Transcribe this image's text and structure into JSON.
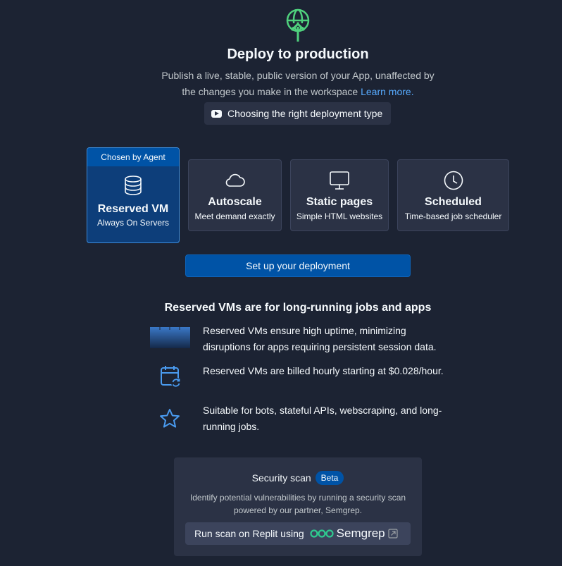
{
  "header": {
    "icon": "globe-upload-icon",
    "title": "Deploy to production",
    "subtitle_line1": "Publish a live, stable, public version of your App, unaffected by",
    "subtitle_line2": "the changes you make in the workspace",
    "learn_more": "Learn more.",
    "video_button": "Choosing the right deployment type"
  },
  "deployment_types": [
    {
      "name": "Reserved VM",
      "desc": "Always On Servers",
      "icon": "database-icon",
      "tag": "Chosen by Agent",
      "selected": true
    },
    {
      "name": "Autoscale",
      "desc": "Meet demand exactly",
      "icon": "cloud-icon",
      "selected": false
    },
    {
      "name": "Static pages",
      "desc": "Simple HTML websites",
      "icon": "monitor-icon",
      "selected": false
    },
    {
      "name": "Scheduled",
      "desc": "Time-based job scheduler",
      "icon": "clock-icon",
      "selected": false
    }
  ],
  "setup_button": "Set up your deployment",
  "info": {
    "title": "Reserved VMs are for long-running jobs and apps",
    "features": [
      {
        "icon": "uptime-bar-icon",
        "text": "Reserved VMs ensure high uptime, minimizing disruptions for apps requiring persistent session data."
      },
      {
        "icon": "calendar-repeat-icon",
        "text": "Reserved VMs are billed hourly starting at $0.028/hour."
      },
      {
        "icon": "star-icon",
        "text": "Suitable for bots, stateful APIs, webscraping, and long-running jobs."
      }
    ]
  },
  "security_scan": {
    "title": "Security scan",
    "badge": "Beta",
    "desc_line1": "Identify potential vulnerabilities by running a security scan",
    "desc_line2": "powered by our partner, Semgrep.",
    "button_label": "Run scan on Replit using",
    "brand": "Semgrep",
    "external_icon": "external-link-icon"
  },
  "colors": {
    "background": "#1c2333",
    "surface": "#2b3245",
    "accent": "#0053a6",
    "link": "#57abff",
    "icon_green": "#4fd17d",
    "icon_blue": "#4a9bf0"
  }
}
